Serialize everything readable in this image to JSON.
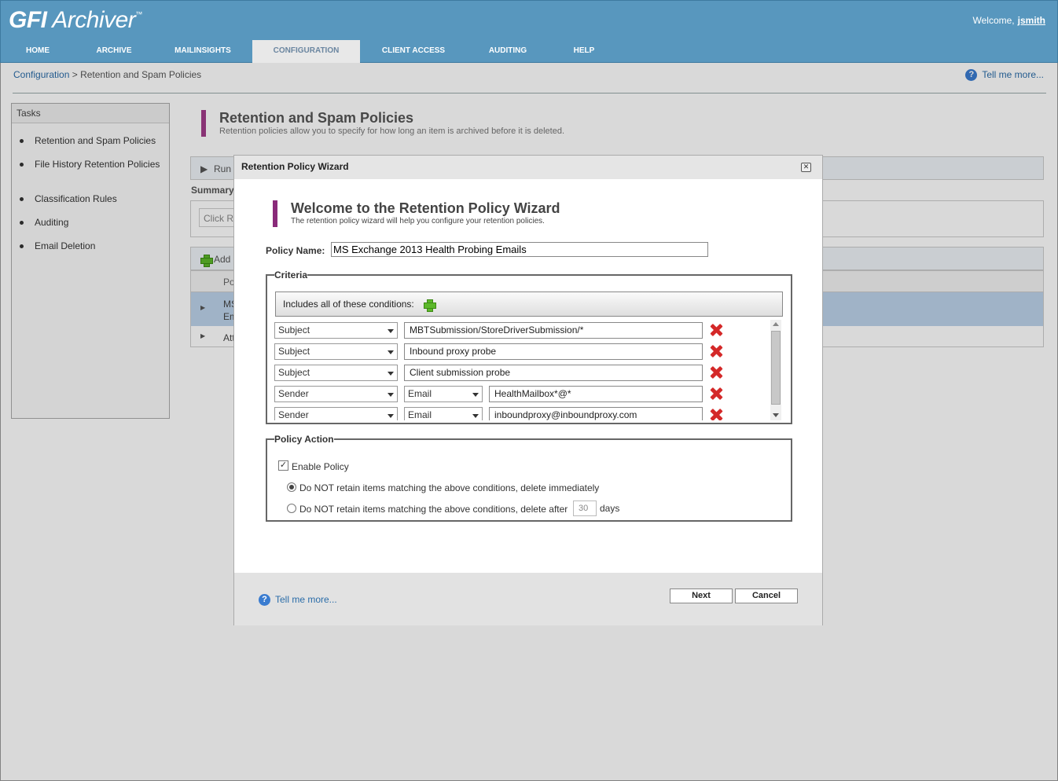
{
  "app": {
    "logo_bold": "GFI",
    "logo_rest": " Archiver",
    "logo_tm": "™",
    "welcome": "Welcome,",
    "username": "jsmith"
  },
  "nav": {
    "tabs": [
      {
        "label": "Home"
      },
      {
        "label": "Archive"
      },
      {
        "label": "MailInsights"
      },
      {
        "label": "Configuration"
      },
      {
        "label": "Client Access"
      },
      {
        "label": "Auditing"
      },
      {
        "label": "Help"
      }
    ],
    "active": "Configuration"
  },
  "breadcrumb": {
    "root": "Configuration",
    "sep": " > ",
    "current": "Retention and Spam Policies"
  },
  "help": {
    "tell_me_more": "Tell me more..."
  },
  "tasks": {
    "title": "Tasks",
    "items": [
      {
        "label": "Retention and Spam Policies"
      },
      {
        "label": "File History Retention Policies"
      },
      {
        "label": "Classification Rules"
      },
      {
        "label": "Auditing"
      },
      {
        "label": "Email Deletion"
      }
    ]
  },
  "page": {
    "title": "Retention and Spam Policies",
    "subtitle": "Retention policies allow you to specify for how long an item is archived before it is deleted.",
    "run_label": "Run",
    "summary_label": "Summary",
    "click_hint": "Click R",
    "add_label": "Add",
    "col_po": "Po",
    "row1_a": "MS",
    "row1_b": "Em",
    "row2": "Att"
  },
  "dialog": {
    "title": "Retention Policy Wizard",
    "heading": "Welcome to the Retention Policy Wizard",
    "subheading": "The retention policy wizard will help you configure your retention policies.",
    "policy_name_label": "Policy Name:",
    "policy_name_value": "MS Exchange 2013 Health Probing Emails",
    "criteria_legend": "Criteria",
    "conditions_label": "Includes all of these conditions:",
    "conditions": [
      {
        "field": "Subject",
        "type": null,
        "value": "MBTSubmission/StoreDriverSubmission/*"
      },
      {
        "field": "Subject",
        "type": null,
        "value": "Inbound proxy probe"
      },
      {
        "field": "Subject",
        "type": null,
        "value": "Client submission probe"
      },
      {
        "field": "Sender",
        "type": "Email",
        "value": "HealthMailbox*@*"
      },
      {
        "field": "Sender",
        "type": "Email",
        "value": "inboundproxy@inboundproxy.com"
      }
    ],
    "action_legend": "Policy Action",
    "enable_policy": "Enable Policy",
    "enable_checked": true,
    "option_immediate": "Do NOT retain items matching the above conditions, delete immediately",
    "option_after": "Do NOT retain items matching the above conditions, delete after",
    "days_value": "30",
    "days_label": "days",
    "selected_option": "immediate",
    "footer_link": "Tell me more...",
    "next": "Next",
    "cancel": "Cancel"
  },
  "colors": {
    "header": "#5897be",
    "accent_bar": "#a23c8a",
    "link": "#2a6ca8",
    "delete": "#d42828",
    "add": "#5cb82a"
  }
}
